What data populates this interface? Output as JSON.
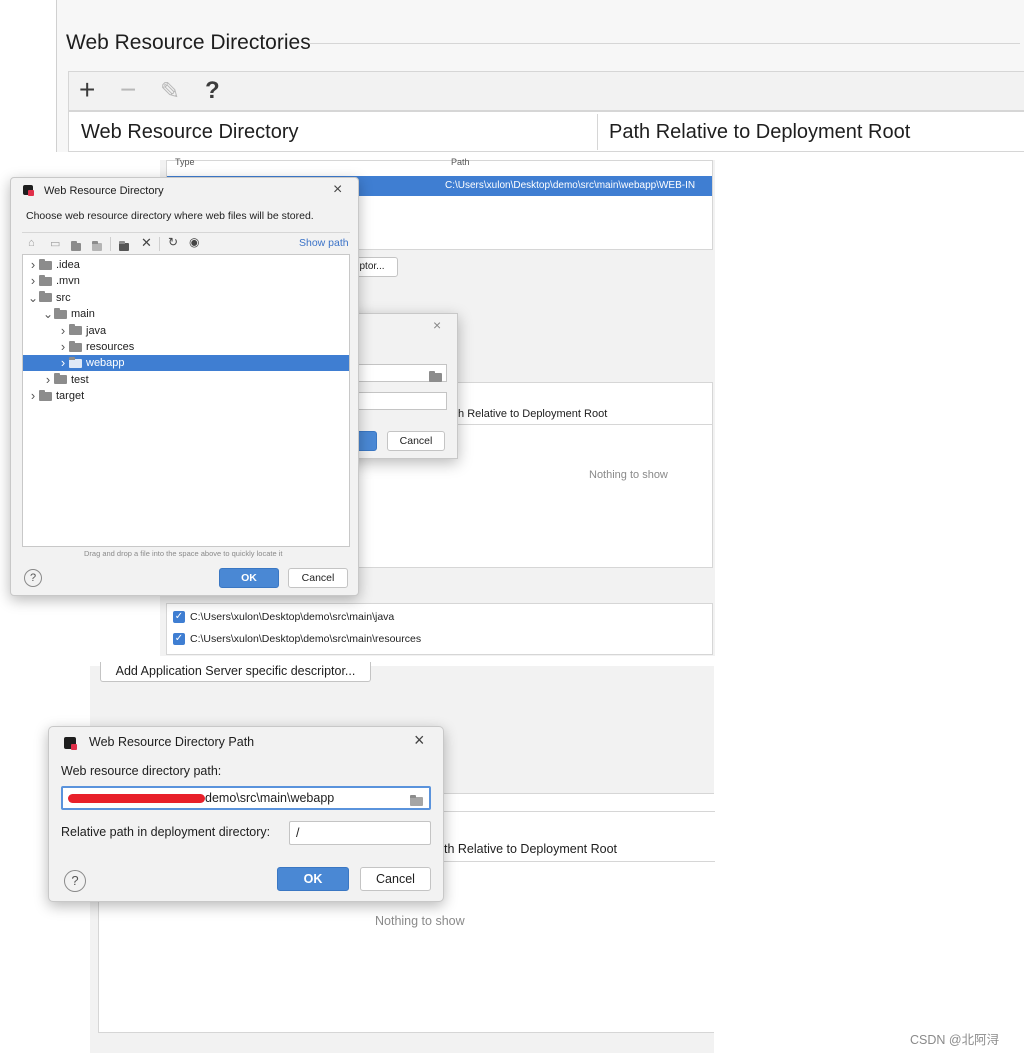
{
  "top_panel": {
    "section_title": "Web Resource Directories",
    "toolbar": {
      "add": "+",
      "remove": "−",
      "edit": "✎",
      "help": "?"
    },
    "columns": [
      "Web Resource Directory",
      "Path Relative to Deployment Root"
    ]
  },
  "middle_panel": {
    "columns": [
      "Type",
      "Path"
    ],
    "selected_path": "C:\\Users\\xulon\\Desktop\\demo\\src\\main\\webapp\\WEB-IN",
    "descriptor_button_partial": "ptor...",
    "column_partial": "th Relative to Deployment Root",
    "nothing_to_show": "Nothing to show",
    "source_roots": [
      "C:\\Users\\xulon\\Desktop\\demo\\src\\main\\java",
      "C:\\Users\\xulon\\Desktop\\demo\\src\\main\\resources"
    ]
  },
  "hidden_dialog": {
    "cancel": "Cancel",
    "close": "×"
  },
  "chooser_dialog": {
    "title": "Web Resource Directory",
    "description": "Choose web resource directory where web files will be stored.",
    "toolbar_icons": [
      "home-icon",
      "desktop-icon",
      "project-icon",
      "module-icon",
      "new-folder-icon",
      "delete-icon",
      "refresh-icon",
      "show-hidden-icon"
    ],
    "show_path": "Show path",
    "tree": [
      {
        "label": ".idea",
        "depth": 0,
        "expanded": false
      },
      {
        "label": ".mvn",
        "depth": 0,
        "expanded": false
      },
      {
        "label": "src",
        "depth": 0,
        "expanded": true
      },
      {
        "label": "main",
        "depth": 1,
        "expanded": true
      },
      {
        "label": "java",
        "depth": 2,
        "expanded": false
      },
      {
        "label": "resources",
        "depth": 2,
        "expanded": false
      },
      {
        "label": "webapp",
        "depth": 2,
        "expanded": false,
        "selected": true
      },
      {
        "label": "test",
        "depth": 1,
        "expanded": false
      },
      {
        "label": "target",
        "depth": 0,
        "expanded": false
      }
    ],
    "hint": "Drag and drop a file into the space above to quickly locate it",
    "ok": "OK",
    "cancel": "Cancel",
    "help": "?",
    "close": "×"
  },
  "bottom_panel": {
    "descriptor_button": "Add Application Server specific descriptor...",
    "column_partial": "th Relative to Deployment Root",
    "nothing_to_show": "Nothing to show"
  },
  "path_dialog": {
    "title": "Web Resource Directory Path",
    "path_label": "Web resource directory path:",
    "path_value": "demo\\src\\main\\webapp",
    "relative_label": "Relative path in deployment directory:",
    "relative_value": "/",
    "ok": "OK",
    "cancel": "Cancel",
    "help": "?",
    "close": "×"
  },
  "watermark": "CSDN @北阿浔",
  "colors": {
    "selection": "#3f7ed2",
    "primary": "#4a88d4",
    "redaction": "#e8202a"
  }
}
